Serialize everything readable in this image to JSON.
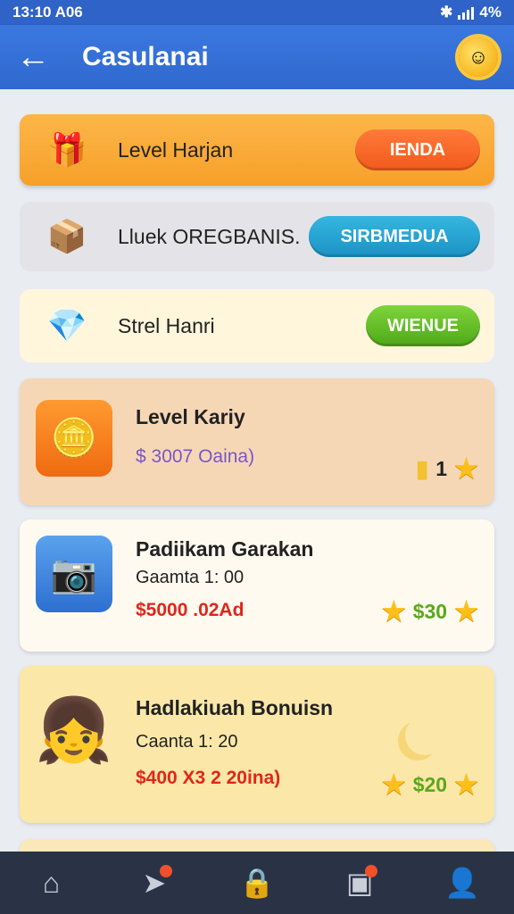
{
  "status": {
    "time": "13:10 A06",
    "battery": "4%"
  },
  "header": {
    "title": "Casulanai"
  },
  "rows": [
    {
      "label": "Level Harjan",
      "button": "IENDA"
    },
    {
      "label": "Lluek OREGBANIS.",
      "button": "SIRBMEDUA"
    },
    {
      "label": "Strel Hanri",
      "button": "WIENUE"
    }
  ],
  "cards": [
    {
      "title": "Level Kariy",
      "price": "$ 3007 Oaina)",
      "count": "1"
    },
    {
      "title": "Padiikam Garakan",
      "subtitle": "Gaamta 1: 00",
      "price": "$5000 .02Ad",
      "reward": "$30"
    },
    {
      "title": "Hadlakiuah Bonuisn",
      "subtitle": "Caanta 1: 20",
      "price": "$400 X3 2 20ina)",
      "reward": "$20"
    }
  ],
  "colors": {
    "accent": "#3068cf",
    "price_red": "#e0261a",
    "price_purple": "#7a56c8",
    "reward_green": "#5aa81c"
  },
  "icons": {
    "back": "arrow-left-icon",
    "profile": "sun-face-icon",
    "nav": [
      "home-icon",
      "send-icon",
      "lock-icon",
      "book-icon",
      "user-icon"
    ]
  }
}
